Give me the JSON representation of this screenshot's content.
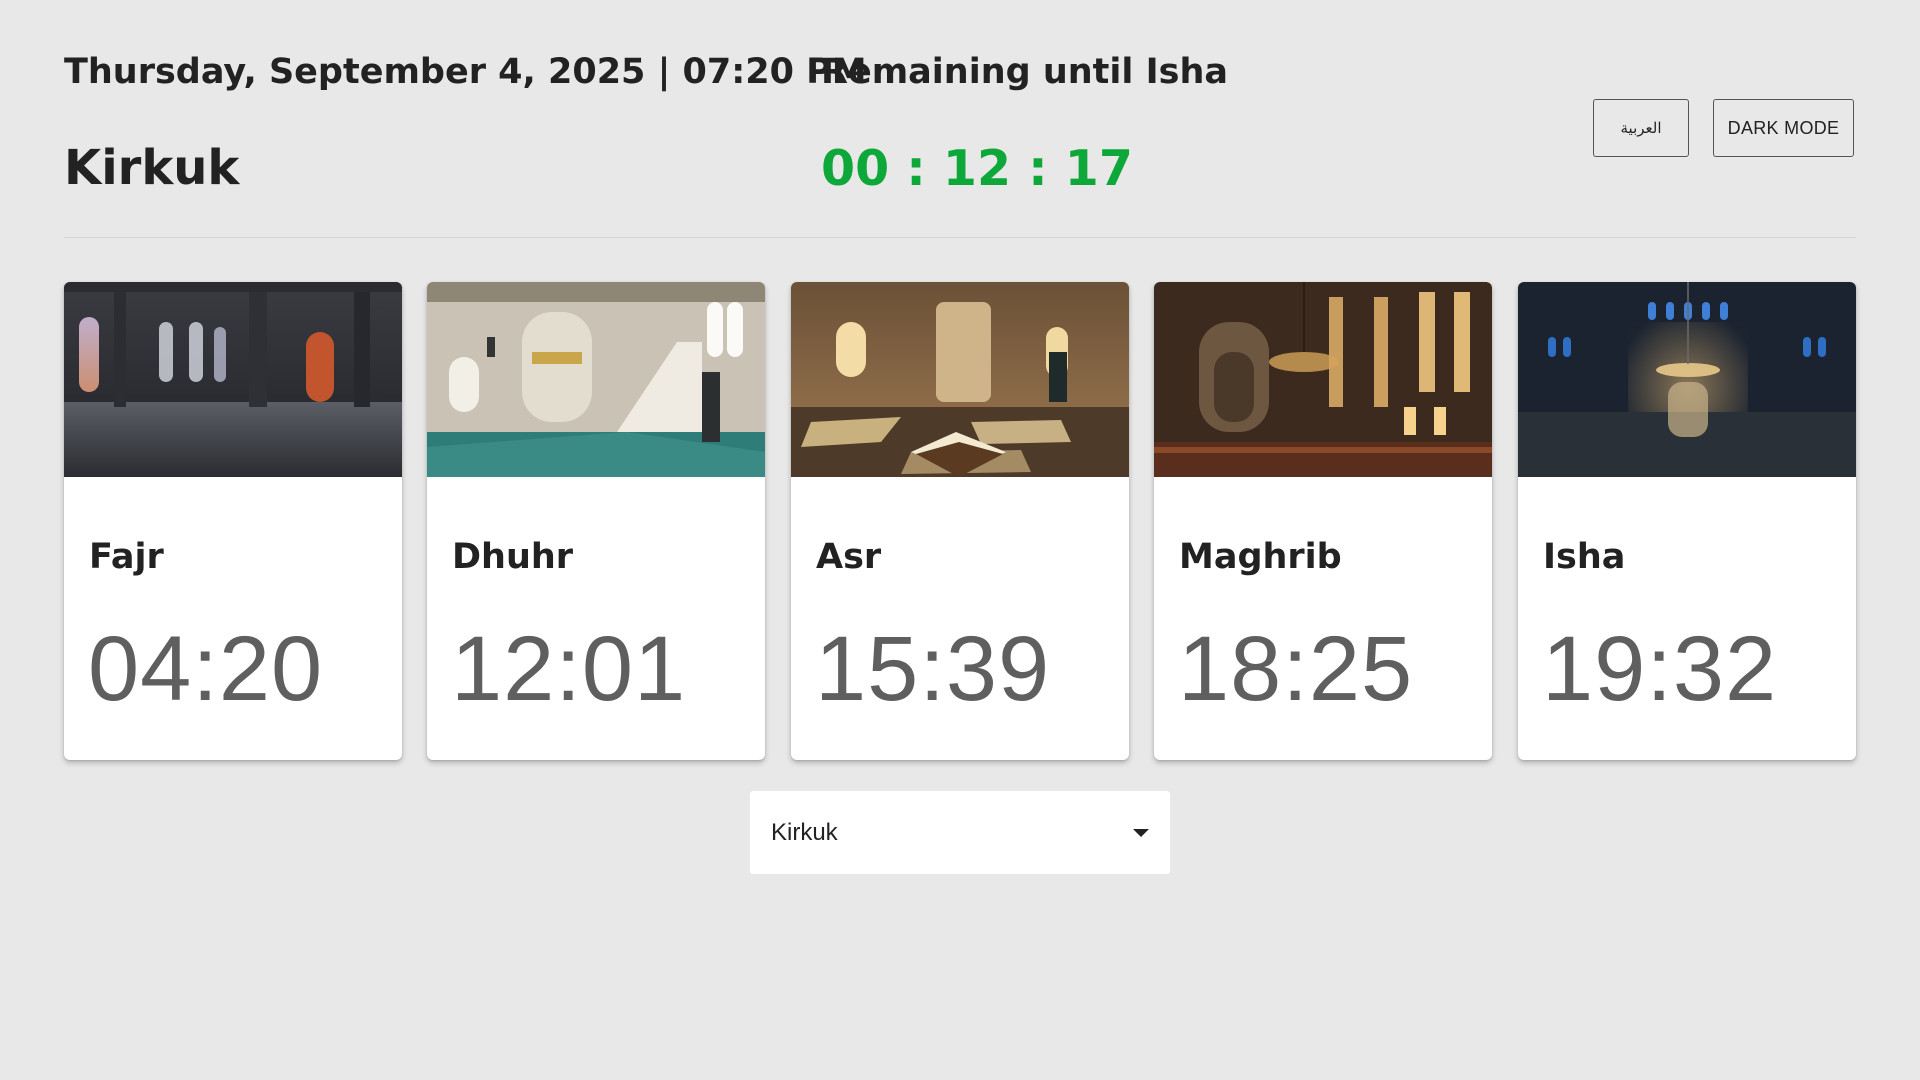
{
  "header": {
    "datetime": "Thursday, September 4, 2025 | 07:20 PM",
    "city": "Kirkuk",
    "remaining_label": "Remaining until Isha",
    "countdown": "00 : 12 : 17",
    "countdown_color": "#0ea83a"
  },
  "buttons": {
    "language": "العربية",
    "dark_mode": "DARK MODE"
  },
  "prayers": [
    {
      "name": "Fajr",
      "time": "04:20",
      "image": "mosque-interior-dawn"
    },
    {
      "name": "Dhuhr",
      "time": "12:01",
      "image": "mosque-interior-minbar-daylight"
    },
    {
      "name": "Asr",
      "time": "15:39",
      "image": "mosque-interior-quran-stand"
    },
    {
      "name": "Maghrib",
      "time": "18:25",
      "image": "mosque-interior-chandelier-sunset"
    },
    {
      "name": "Isha",
      "time": "19:32",
      "image": "mosque-interior-night"
    }
  ],
  "city_select": {
    "selected": "Kirkuk",
    "icon": "caret-down-icon"
  }
}
